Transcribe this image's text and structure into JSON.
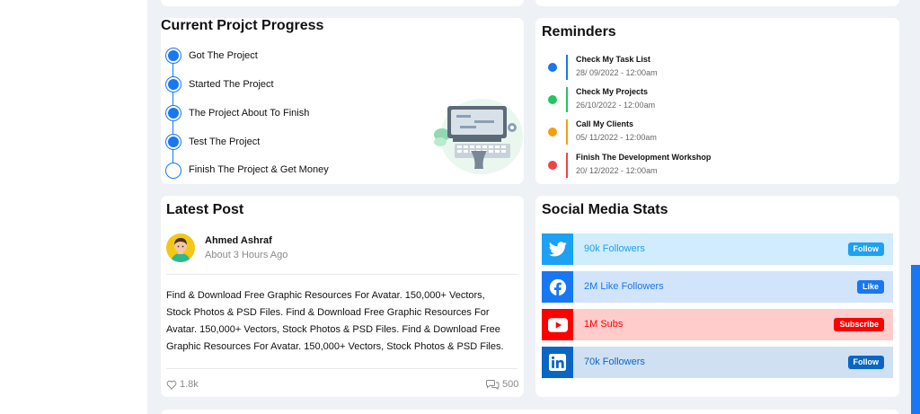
{
  "progress": {
    "title": "Current Projct Progress",
    "steps": [
      {
        "label": "Got The Project",
        "done": true
      },
      {
        "label": "Started The Project",
        "done": true
      },
      {
        "label": "The Project About To Finish",
        "done": true
      },
      {
        "label": "Test The Project",
        "done": true
      },
      {
        "label": "Finish The Project & Get Money",
        "done": false
      }
    ]
  },
  "reminders": {
    "title": "Reminders",
    "items": [
      {
        "title": "Check My Task List",
        "date": "28/ 09/2022 - 12:00am",
        "color": "#1877f2"
      },
      {
        "title": "Check My Projects",
        "date": "26/10/2022 - 12:00am",
        "color": "#22c55e"
      },
      {
        "title": "Call My Clients",
        "date": "05/ 11/2022 - 12:00am",
        "color": "#f59e0b"
      },
      {
        "title": "Finish The Development Workshop",
        "date": "20/ 12/2022 - 12:00am",
        "color": "#ef4444"
      }
    ]
  },
  "latest_post": {
    "title": "Latest Post",
    "author": "Ahmed Ashraf",
    "time": "About 3 Hours Ago",
    "body": "Find & Download Free Graphic Resources For Avatar. 150,000+ Vectors, Stock Photos & PSD Files. Find & Download Free Graphic Resources For Avatar. 150,000+ Vectors, Stock Photos & PSD Files. Find & Download Free Graphic Resources For Avatar. 150,000+ Vectors, Stock Photos & PSD Files.",
    "likes": "1.8k",
    "comments": "500"
  },
  "social": {
    "title": "Social Media Stats",
    "rows": [
      {
        "network": "twitter-icon",
        "text": "90k Followers",
        "button": "Follow",
        "icon_bg": "#1da1f2",
        "row_bg": "#d1ecfc",
        "btn_bg": "#1da1f2",
        "text_color": "#1da1f2"
      },
      {
        "network": "facebook-icon",
        "text": "2M Like Followers",
        "button": "Like",
        "icon_bg": "#1877f2",
        "row_bg": "#d1e4fc",
        "btn_bg": "#1877f2",
        "text_color": "#1877f2"
      },
      {
        "network": "youtube-icon",
        "text": "1M Subs",
        "button": "Subscribe",
        "icon_bg": "#ff0000",
        "row_bg": "#ffcccc",
        "btn_bg": "#ff0000",
        "text_color": "#ff0000"
      },
      {
        "network": "linkedin-icon",
        "text": "70k Followers",
        "button": "Follow",
        "icon_bg": "#0a66c2",
        "row_bg": "#cfe0f3",
        "btn_bg": "#0a66c2",
        "text_color": "#0a66c2"
      }
    ]
  }
}
